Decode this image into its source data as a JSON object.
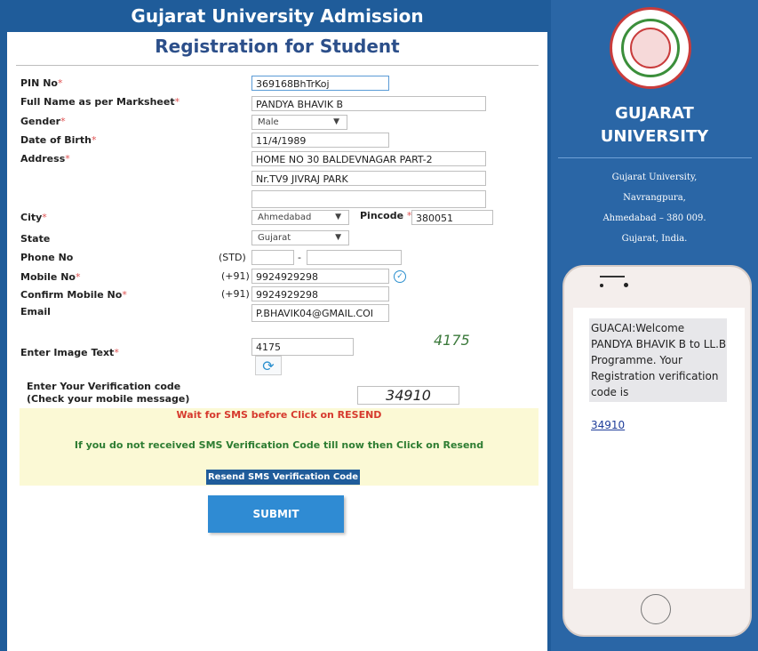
{
  "header": {
    "title": "Gujarat University Admission",
    "subtitle": "Registration for Student"
  },
  "form": {
    "labels": {
      "pin": "PIN No",
      "fullname": "Full Name as per Marksheet",
      "gender": "Gender",
      "dob": "Date of Birth",
      "address": "Address",
      "city": "City",
      "pincode": "Pincode",
      "state": "State",
      "phone": "Phone No",
      "mobile": "Mobile No",
      "confirm_mobile": "Confirm Mobile No",
      "email": "Email",
      "image_text": "Enter Image Text",
      "verification_line1": "Enter Your Verification code",
      "verification_line2": "(Check your mobile message)"
    },
    "required_mark": "*",
    "values": {
      "pin": "369168BhTrKoj",
      "fullname": "PANDYA BHAVIK B",
      "gender": "Male",
      "dob": "11/4/1989",
      "address1": "HOME NO 30 BALDEVNAGAR PART-2",
      "address2": "Nr.TV9 JIVRAJ PARK",
      "address3": "",
      "city": "Ahmedabad",
      "pincode": "380051",
      "state": "Gujarat",
      "phone_std": "",
      "phone_number": "",
      "mobile": "9924929298",
      "confirm_mobile": "9924929298",
      "email": "P.BHAVIK04@GMAIL.COI",
      "image_text": "4175",
      "verification_code": "34910"
    },
    "prefixes": {
      "std": "(STD)",
      "country_code": "(+91)",
      "phone_sep": "-"
    },
    "captcha_text": "4175",
    "notices": {
      "wait": "Wait for SMS before Click on RESEND",
      "resend_info": "If you do not received SMS Verification Code till now then Click on Resend"
    },
    "buttons": {
      "resend": "Resend SMS Verification Code",
      "submit": "SUBMIT"
    }
  },
  "sidebar": {
    "university_line1": "GUJARAT",
    "university_line2": "UNIVERSITY",
    "address_lines": [
      "Gujarat University,",
      "Navrangpura,",
      "Ahmedabad – 380 009.",
      "Gujarat, India."
    ]
  },
  "phone": {
    "sms_text": "GUACAI:Welcome PANDYA BHAVIK B to LL.B Programme. Your Registration verification code is",
    "sms_code": "34910"
  },
  "colors": {
    "header_blue": "#1f5c9a",
    "submit_blue": "#2f8bd3",
    "notice_yellow": "#fbf9d5",
    "wait_red": "#d63a2e",
    "info_green": "#2e7d32"
  }
}
